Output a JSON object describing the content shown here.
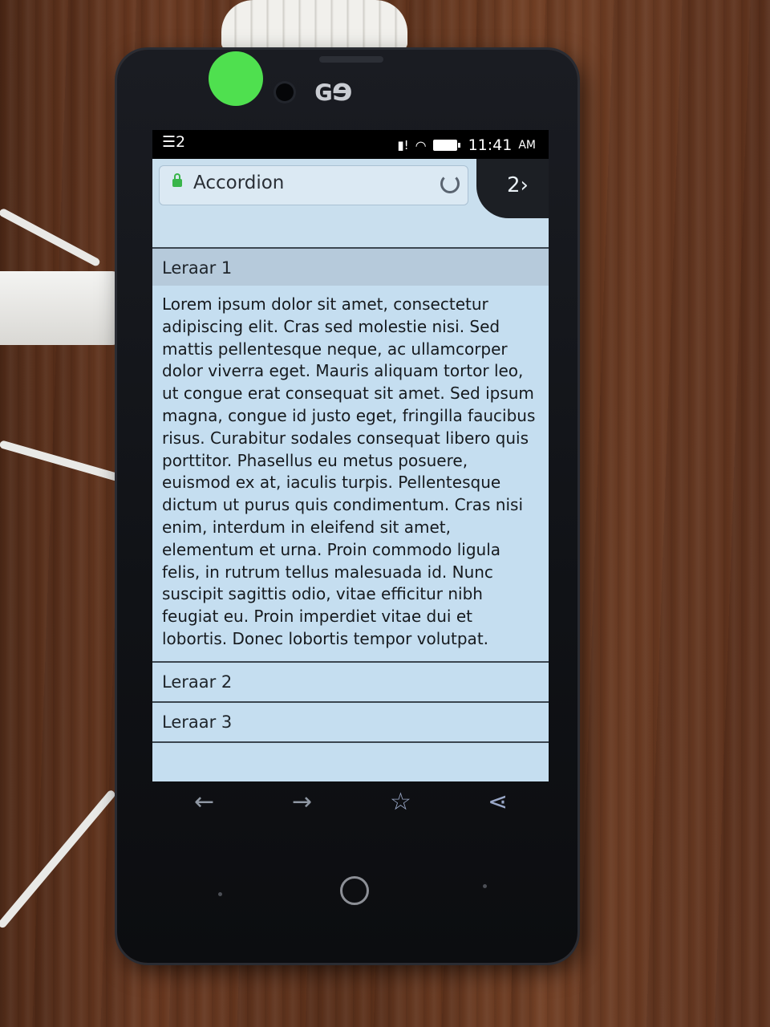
{
  "status_bar": {
    "notification_count": "2",
    "time": "11:41",
    "ampm": "AM"
  },
  "brand": {
    "logo": "ɢɘ"
  },
  "browser": {
    "url_title": "Accordion",
    "tab_count": "2›"
  },
  "accordion": {
    "sections": [
      {
        "label": "Leraar 1"
      },
      {
        "label": "Leraar 2"
      },
      {
        "label": "Leraar 3"
      }
    ],
    "body_text": "Lorem ipsum dolor sit amet, consectetur adipiscing elit. Cras sed molestie nisi. Sed mattis pellentesque neque, ac ullamcorper dolor viverra eget. Mauris aliquam tortor leo, ut congue erat consequat sit amet. Sed ipsum magna, congue id justo eget, fringilla faucibus risus. Curabitur sodales consequat libero quis porttitor. Phasellus eu metus posuere, euismod ex at, iaculis turpis. Pellentesque dictum ut purus quis condimentum. Cras nisi enim, interdum in eleifend sit amet, elementum et urna. Proin commodo ligula felis, in rutrum tellus malesuada id. Nunc suscipit sagittis odio, vitae efficitur nibh feugiat eu. Proin imperdiet vitae dui et lobortis. Donec lobortis tempor volutpat."
  },
  "toolbar": {
    "back_icon": "←",
    "forward_icon": "→",
    "bookmark_icon": "☆",
    "share_icon": "⋖"
  },
  "colors": {
    "page_background": "#c5def0",
    "lock": "#39b54a",
    "sticker": "#4fe04f"
  }
}
